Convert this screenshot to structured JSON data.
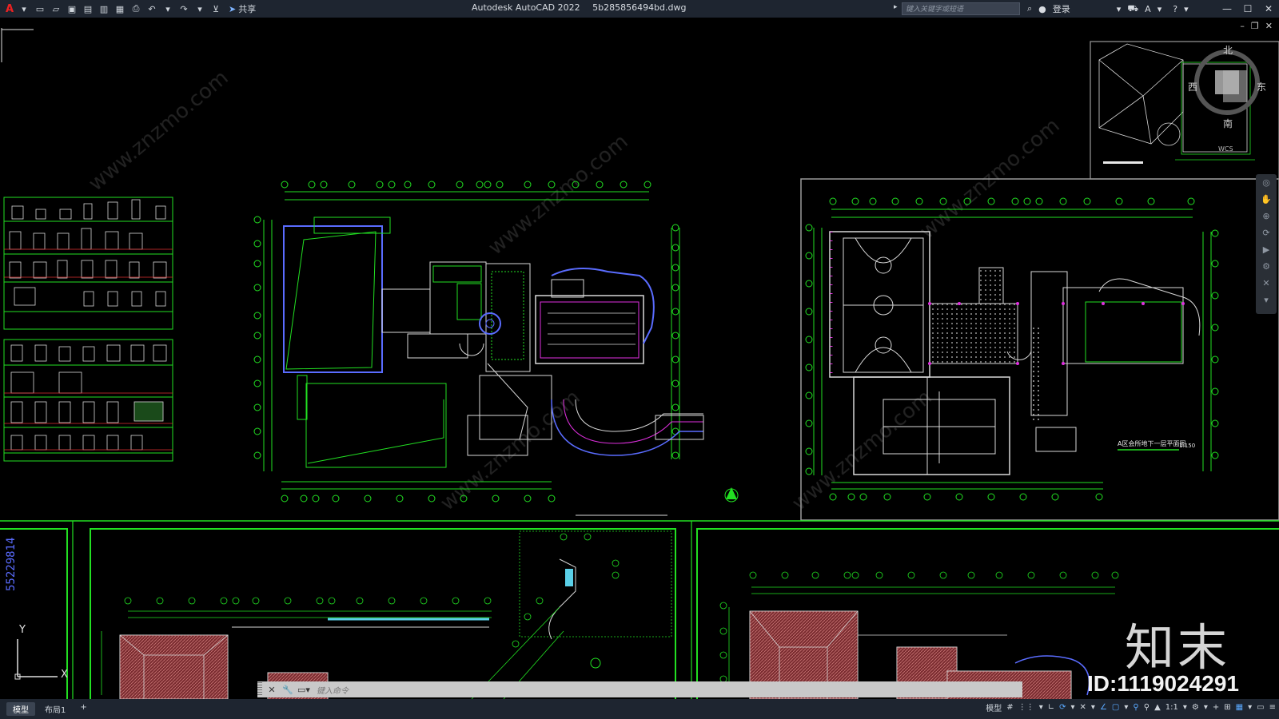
{
  "titlebar": {
    "app_logo": "A",
    "app_name": "Autodesk AutoCAD 2022",
    "file_name": "5b285856494bd.dwg",
    "share_label": "共享",
    "search_placeholder": "键入关键字或短语",
    "login_label": "登录",
    "help_label": "?"
  },
  "viewcube": {
    "north": "北",
    "east": "东",
    "west": "西",
    "south": "南",
    "wcs": "WCS"
  },
  "drawing": {
    "plan_title": "A区会所地下一层平面图",
    "plan_scale": "1:150",
    "left_dim_text": "55229814"
  },
  "ucs": {
    "x": "X",
    "y": "Y"
  },
  "watermark": {
    "logo": "知末",
    "id": "ID:1119024291",
    "site": "www.znzmo.com"
  },
  "cmdline": {
    "placeholder": "键入命令"
  },
  "statusbar": {
    "tabs": [
      {
        "label": "模型",
        "active": true
      },
      {
        "label": "布局1",
        "active": false
      }
    ],
    "add_tab": "+",
    "model_label": "模型",
    "scale_label": "1:1"
  },
  "colors": {
    "cad_green": "#22e022",
    "cad_white": "#e8e8e8",
    "cad_blue": "#5a6cff",
    "cad_magenta": "#e030e0",
    "roof_red": "#9b3a3a",
    "titlebar_bg": "#1e2530"
  }
}
